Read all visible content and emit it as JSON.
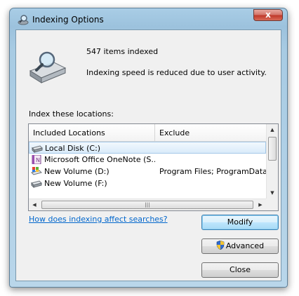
{
  "window": {
    "title": "Indexing Options",
    "close_glyph": "x"
  },
  "summary": {
    "items_indexed": "547 items indexed",
    "status": "Indexing speed is reduced due to user activity."
  },
  "locations": {
    "label": "Index these locations:",
    "columns": [
      "Included Locations",
      "Exclude"
    ],
    "rows": [
      {
        "name": "Local Disk (C:)",
        "exclude": "",
        "icon": "hard-drive-icon",
        "selected": true
      },
      {
        "name": "Microsoft Office OneNote (S...",
        "exclude": "",
        "icon": "onenote-icon",
        "selected": false
      },
      {
        "name": "New Volume (D:)",
        "exclude": "Program Files; ProgramData; D",
        "icon": "drive-windows-icon",
        "selected": false
      },
      {
        "name": "New Volume (F:)",
        "exclude": "",
        "icon": "hard-drive-icon",
        "selected": false
      }
    ]
  },
  "help_link": "How does indexing affect searches?",
  "buttons": {
    "modify": "Modify",
    "advanced": "Advanced",
    "close": "Close"
  },
  "colors": {
    "link": "#0066cc",
    "selection": "#d9ebfa",
    "frame": "#a9cde6"
  }
}
